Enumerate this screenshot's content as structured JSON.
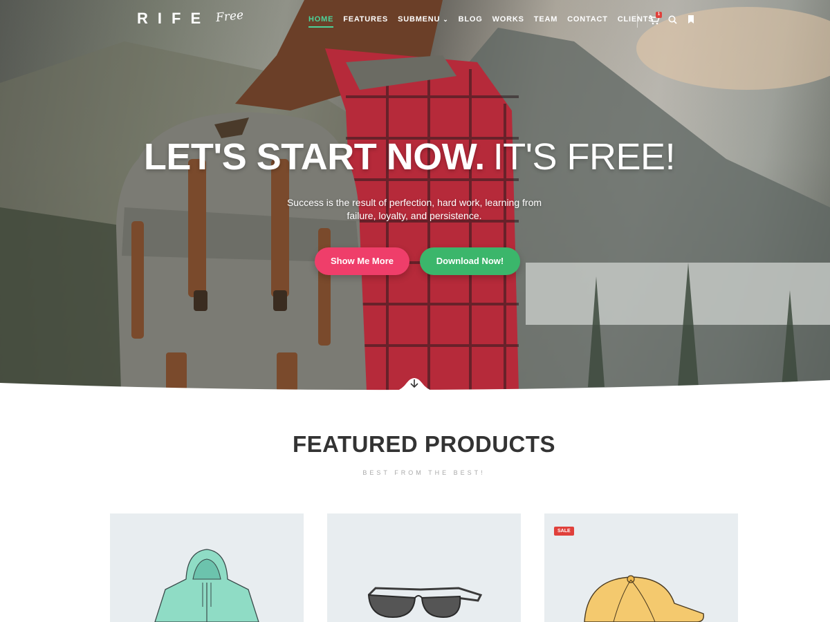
{
  "brand": {
    "name": "RIFE",
    "script": "Free"
  },
  "nav": {
    "items": [
      {
        "label": "HOME",
        "active": true
      },
      {
        "label": "FEATURES"
      },
      {
        "label": "SUBMENU",
        "has_dropdown": true
      },
      {
        "label": "BLOG"
      },
      {
        "label": "WORKS"
      },
      {
        "label": "TEAM"
      },
      {
        "label": "CONTACT"
      },
      {
        "label": "CLIENTS"
      }
    ],
    "cart_count": "1",
    "icons": [
      "cart-icon",
      "search-icon",
      "bookmark-icon"
    ]
  },
  "hero": {
    "title_strong": "LET'S START NOW.",
    "title_light": "IT'S FREE!",
    "subtitle": "Success is the result of perfection, hard work, learning from failure, loyalty, and persistence.",
    "button_primary": "Show Me More",
    "button_secondary": "Download Now!"
  },
  "featured": {
    "title": "FEATURED PRODUCTS",
    "subtitle": "BEST FROM THE BEST!",
    "products": [
      {
        "image": "hoodie",
        "badge": ""
      },
      {
        "image": "sunglasses",
        "badge": ""
      },
      {
        "image": "cap",
        "badge": "SALE"
      }
    ]
  },
  "colors": {
    "accent_green": "#4cd39a",
    "button_pink": "#ef3e6a",
    "button_green": "#3bb66b",
    "sale_red": "#e0403b",
    "heading": "#333333",
    "card_bg": "#e8edf0"
  }
}
